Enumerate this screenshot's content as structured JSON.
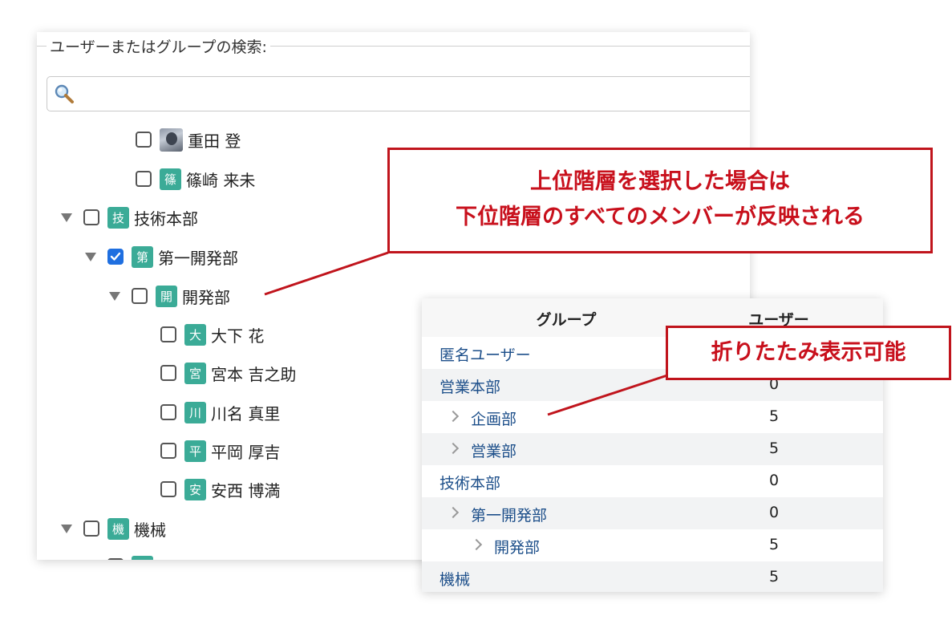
{
  "search": {
    "legend": "ユーザーまたはグループの検索:",
    "placeholder": ""
  },
  "tree": [
    {
      "label": "重田 登",
      "badge": "",
      "photo": true,
      "checked": false
    },
    {
      "label": "篠崎 来未",
      "badge": "篠",
      "checked": false
    },
    {
      "label": "技術本部",
      "badge": "技",
      "expanded": true,
      "checked": false
    },
    {
      "label": "第一開発部",
      "badge": "第",
      "expanded": true,
      "checked": true
    },
    {
      "label": "開発部",
      "badge": "開",
      "expanded": true,
      "checked": false
    },
    {
      "label": "大下 花",
      "badge": "大",
      "checked": false
    },
    {
      "label": "宮本 吉之助",
      "badge": "宮",
      "checked": false
    },
    {
      "label": "川名 真里",
      "badge": "川",
      "checked": false
    },
    {
      "label": "平岡 厚吉",
      "badge": "平",
      "checked": false
    },
    {
      "label": "安西 博満",
      "badge": "安",
      "checked": false
    },
    {
      "label": "機械",
      "badge": "機",
      "expanded": true,
      "checked": false
    }
  ],
  "callouts": {
    "hierarchy_line1": "上位階層を選択した場合は",
    "hierarchy_line2": "下位階層のすべてのメンバーが反映される",
    "collapse": "折りたたみ表示可能"
  },
  "group_table": {
    "headers": {
      "group": "グループ",
      "users": "ユーザー"
    },
    "rows": [
      {
        "name": "匿名ユーザー",
        "count": ""
      },
      {
        "name": "営業本部",
        "count": "0"
      },
      {
        "name": "企画部",
        "count": "5"
      },
      {
        "name": "営業部",
        "count": "5"
      },
      {
        "name": "技術本部",
        "count": "0"
      },
      {
        "name": "第一開発部",
        "count": "0"
      },
      {
        "name": "開発部",
        "count": "5"
      },
      {
        "name": "機械",
        "count": "5"
      }
    ]
  },
  "colors": {
    "accent_red": "#c0141c",
    "badge_green": "#3bab97",
    "link_blue": "#1d4f8a",
    "checkbox_blue": "#1f6fe0"
  }
}
